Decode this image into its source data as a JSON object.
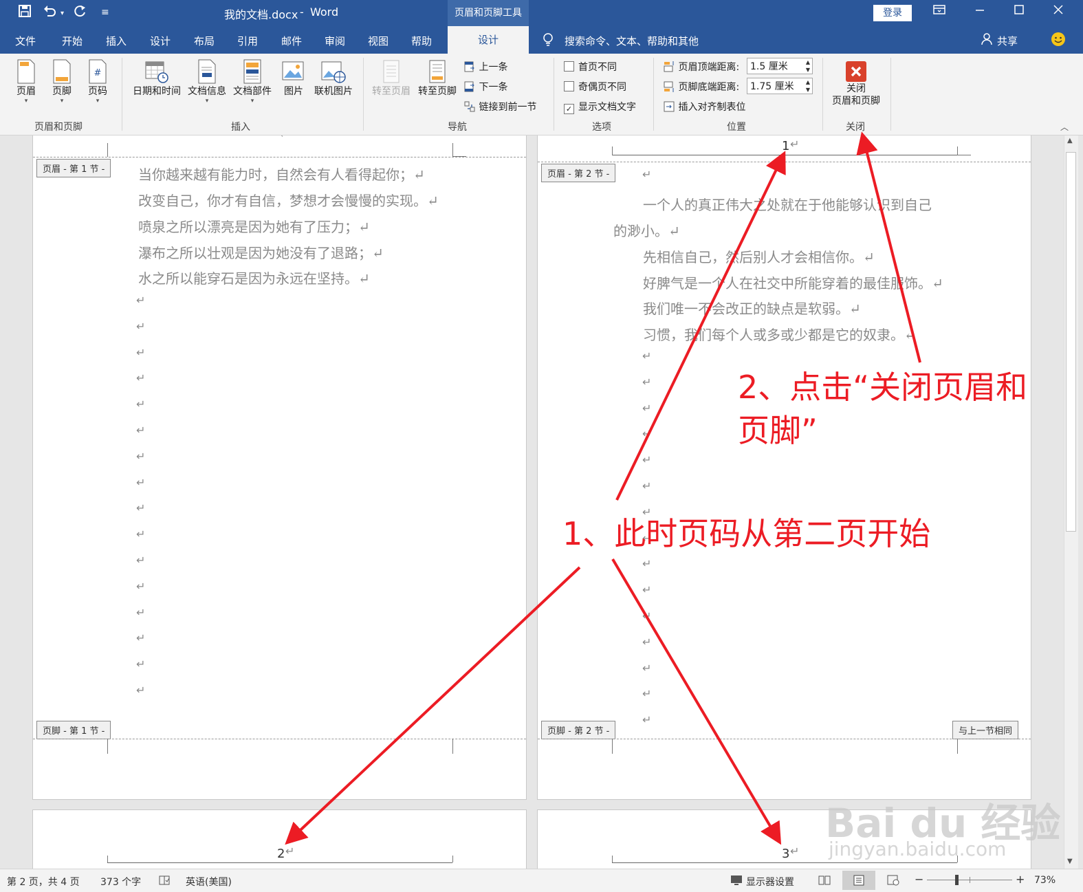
{
  "title_bar": {
    "doc_title": "我的文档.docx",
    "separator": "-",
    "app_name": "Word",
    "context_tab_group": "页眉和页脚工具",
    "login_label": "登录"
  },
  "tabs": [
    "文件",
    "开始",
    "插入",
    "设计",
    "布局",
    "引用",
    "邮件",
    "审阅",
    "视图",
    "帮助"
  ],
  "active_tab": "设计",
  "search_hint": "搜索命令、文本、帮助和其他",
  "share_label": "共享",
  "ribbon": {
    "group_header_footer": {
      "label": "页眉和页脚",
      "buttons": [
        "页眉",
        "页脚",
        "页码"
      ]
    },
    "group_insert": {
      "label": "插入",
      "buttons": [
        "日期和时间",
        "文档信息",
        "文档部件",
        "图片",
        "联机图片"
      ]
    },
    "group_nav": {
      "label": "导航",
      "goto_header": "转至页眉",
      "goto_footer": "转至页脚",
      "prev": "上一条",
      "next": "下一条",
      "link_prev": "链接到前一节"
    },
    "group_options": {
      "label": "选项",
      "first_page_diff": "首页不同",
      "odd_even_diff": "奇偶页不同",
      "show_doc_text": "显示文档文字"
    },
    "group_position": {
      "label": "位置",
      "header_top_label": "页眉顶端距离:",
      "header_top_value": "1.5 厘米",
      "footer_bottom_label": "页脚底端距离:",
      "footer_bottom_value": "1.75 厘米",
      "insert_align_tab": "插入对齐制表位"
    },
    "group_close": {
      "label": "关闭",
      "close_line1": "关闭",
      "close_line2": "页眉和页脚"
    }
  },
  "page1": {
    "header_tag": "页眉 - 第 1 节 -",
    "footer_tag": "页脚 - 第 1 节 -",
    "lines": [
      "当你越来越有能力时，自然会有人看得起你；↵",
      "改变自己，你才有自信，梦想才会慢慢的实现。↵",
      "喷泉之所以漂亮是因为她有了压力；↵",
      "瀑布之所以壮观是因为她没有了退路；↵",
      "水之所以能穿石是因为永远在坚持。↵"
    ]
  },
  "page2": {
    "header_tag": "页眉 - 第 2 节 -",
    "footer_tag": "页脚 - 第 2 节 -",
    "same_as_prev": "与上一节相同",
    "page_number": "1",
    "lines": [
      "一个人的真正伟大之处就在于他能够认识到自己",
      "的渺小。↵",
      "先相信自己，然后别人才会相信你。↵",
      "好脾气是一个人在社交中所能穿着的最佳服饰。↵",
      "我们唯一不会改正的缺点是软弱。↵",
      "习惯，我们每个人或多或少都是它的奴隶。↵"
    ]
  },
  "page3": {
    "page_number": "2"
  },
  "page4": {
    "page_number": "3"
  },
  "return_mark": "↵",
  "annotations": {
    "step1": "1、此时页码从第二页开始",
    "step2_line1": "2、点击“关闭页眉和",
    "step2_line2": "页脚”"
  },
  "watermark": {
    "main": "Bai du 经验",
    "url": "jingyan.baidu.com"
  },
  "status_bar": {
    "page_info": "第 2 页，共 4 页",
    "word_count": "373 个字",
    "language": "英语(美国)",
    "display_settings": "显示器设置",
    "zoom": "73%"
  },
  "colors": {
    "word_blue": "#2b579a",
    "annotation_red": "#ec1c24",
    "close_icon_red": "#d9412b"
  }
}
